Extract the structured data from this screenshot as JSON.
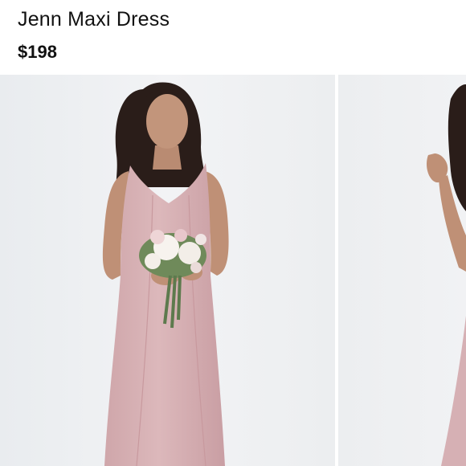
{
  "product": {
    "title": "Jenn Maxi Dress",
    "price": "$198"
  },
  "gallery": {
    "images": [
      {
        "subject": "model-in-pink-maxi-dress-holding-bouquet"
      },
      {
        "subject": "model-in-pink-maxi-dress-side-view"
      }
    ]
  },
  "colors": {
    "background": "#ffffff",
    "photo_backdrop": "#eef0f2",
    "dress": "#d9b3b6",
    "text": "#111111"
  }
}
